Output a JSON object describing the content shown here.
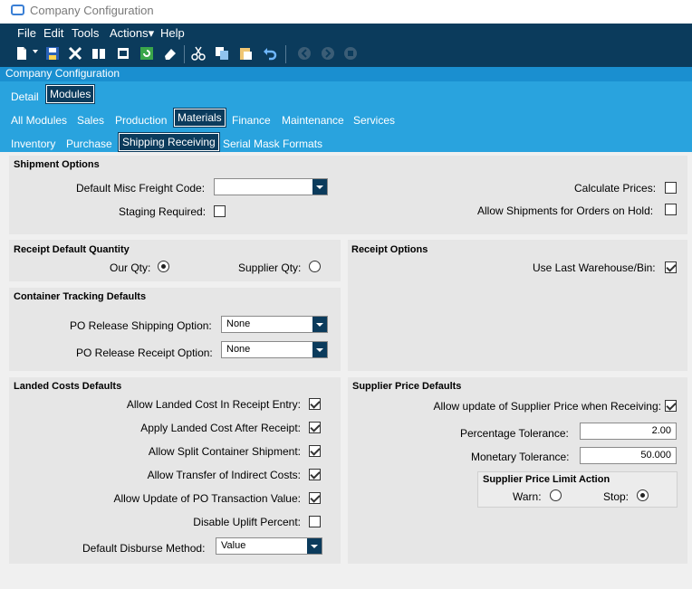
{
  "window": {
    "title": "Company Configuration"
  },
  "menu": [
    "File",
    "Edit",
    "Tools",
    "Actions▾",
    "Help"
  ],
  "toolbar": {
    "icons": [
      "new-icon",
      "save-icon",
      "delete-icon",
      "open-book-icon",
      "print-icon",
      "refresh-icon",
      "eraser-icon",
      "cut-icon",
      "copy-icon",
      "paste-icon",
      "undo-icon",
      "back-icon",
      "forward-icon",
      "stop-icon"
    ]
  },
  "module_title": "Company Configuration",
  "tabs": {
    "level1": [
      "Detail",
      "Modules"
    ],
    "level1_selected": "Modules",
    "level2": [
      "All Modules",
      "Sales",
      "Production",
      "Materials",
      "Finance",
      "Maintenance",
      "Services"
    ],
    "level2_selected": "Materials",
    "level3": [
      "Inventory",
      "Purchase",
      "Shipping Receiving",
      "Serial Mask Formats"
    ],
    "level3_selected": "Shipping Receiving"
  },
  "shipment_options": {
    "title": "Shipment Options",
    "default_misc_freight_code_label": "Default Misc Freight Code:",
    "default_misc_freight_code_value": "",
    "staging_required_label": "Staging Required:",
    "staging_required": false,
    "calculate_prices_label": "Calculate Prices:",
    "calculate_prices": false,
    "allow_shipments_on_hold_label": "Allow Shipments for Orders on Hold:",
    "allow_shipments_on_hold": false
  },
  "receipt_default_quantity": {
    "title": "Receipt Default Quantity",
    "our_qty_label": "Our Qty:",
    "supplier_qty_label": "Supplier Qty:",
    "selected": "Our Qty"
  },
  "receipt_options": {
    "title": "Receipt Options",
    "use_last_warehouse_bin_label": "Use Last Warehouse/Bin:",
    "use_last_warehouse_bin": true
  },
  "container_tracking_defaults": {
    "title": "Container Tracking Defaults",
    "po_release_shipping_label": "PO Release Shipping Option:",
    "po_release_shipping_value": "None",
    "po_release_receipt_label": "PO Release Receipt Option:",
    "po_release_receipt_value": "None"
  },
  "landed_costs_defaults": {
    "title": "Landed Costs Defaults",
    "items": [
      {
        "label": "Allow Landed Cost In Receipt Entry:",
        "checked": true
      },
      {
        "label": "Apply Landed Cost After Receipt:",
        "checked": true
      },
      {
        "label": "Allow Split Container Shipment:",
        "checked": true
      },
      {
        "label": "Allow Transfer of Indirect Costs:",
        "checked": true
      },
      {
        "label": "Allow Update of PO Transaction Value:",
        "checked": true
      },
      {
        "label": "Disable Uplift Percent:",
        "checked": false
      }
    ],
    "default_disburse_method_label": "Default Disburse Method:",
    "default_disburse_method_value": "Value"
  },
  "supplier_price_defaults": {
    "title": "Supplier Price Defaults",
    "allow_update_label": "Allow update of Supplier Price when Receiving:",
    "allow_update": true,
    "percentage_tolerance_label": "Percentage Tolerance:",
    "percentage_tolerance_value": "2.00",
    "monetary_tolerance_label": "Monetary Tolerance:",
    "monetary_tolerance_value": "50.000",
    "limit_action_title": "Supplier Price Limit Action",
    "warn_label": "Warn:",
    "stop_label": "Stop:",
    "limit_action_selected": "Stop"
  }
}
